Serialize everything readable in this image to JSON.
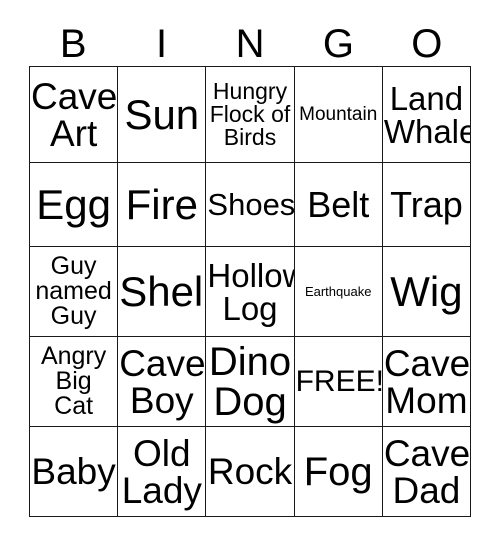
{
  "card": {
    "title": "BINGO",
    "header_letters": [
      "B",
      "I",
      "N",
      "G",
      "O"
    ],
    "free_space_label": "FREE!",
    "colors": {
      "background": "#ffffff",
      "border": "#1a1a1a",
      "text": "#000000"
    },
    "rows": [
      [
        {
          "text": "Cave\nArt",
          "size": "fs-37"
        },
        {
          "text": "Sun",
          "size": "fs-42"
        },
        {
          "text": "Hungry\nFlock of\nBirds",
          "size": "fs-23"
        },
        {
          "text": "Mountain",
          "size": "fs-19"
        },
        {
          "text": "Land\nWhale",
          "size": "fs-33"
        }
      ],
      [
        {
          "text": "Egg",
          "size": "fs-42"
        },
        {
          "text": "Fire",
          "size": "fs-42"
        },
        {
          "text": "Shoes",
          "size": "fs-31"
        },
        {
          "text": "Belt",
          "size": "fs-36"
        },
        {
          "text": "Trap",
          "size": "fs-36"
        }
      ],
      [
        {
          "text": "Guy\nnamed\nGuy",
          "size": "fs-25"
        },
        {
          "text": "Shell",
          "size": "fs-42"
        },
        {
          "text": "Hollow\nLog",
          "size": "fs-33"
        },
        {
          "text": "Earthquake",
          "size": "fs-13"
        },
        {
          "text": "Wig",
          "size": "fs-42"
        }
      ],
      [
        {
          "text": "Angry\nBig\nCat",
          "size": "fs-25"
        },
        {
          "text": "Cave\nBoy",
          "size": "fs-37"
        },
        {
          "text": "Dino\nDog",
          "size": "fs-40"
        },
        {
          "text": "FREE!",
          "size": "fs-30"
        },
        {
          "text": "Cave\nMom",
          "size": "fs-37"
        }
      ],
      [
        {
          "text": "Baby",
          "size": "fs-37"
        },
        {
          "text": "Old\nLady",
          "size": "fs-37"
        },
        {
          "text": "Rock",
          "size": "fs-37"
        },
        {
          "text": "Fog",
          "size": "fs-40"
        },
        {
          "text": "Cave\nDad",
          "size": "fs-37"
        }
      ]
    ]
  }
}
